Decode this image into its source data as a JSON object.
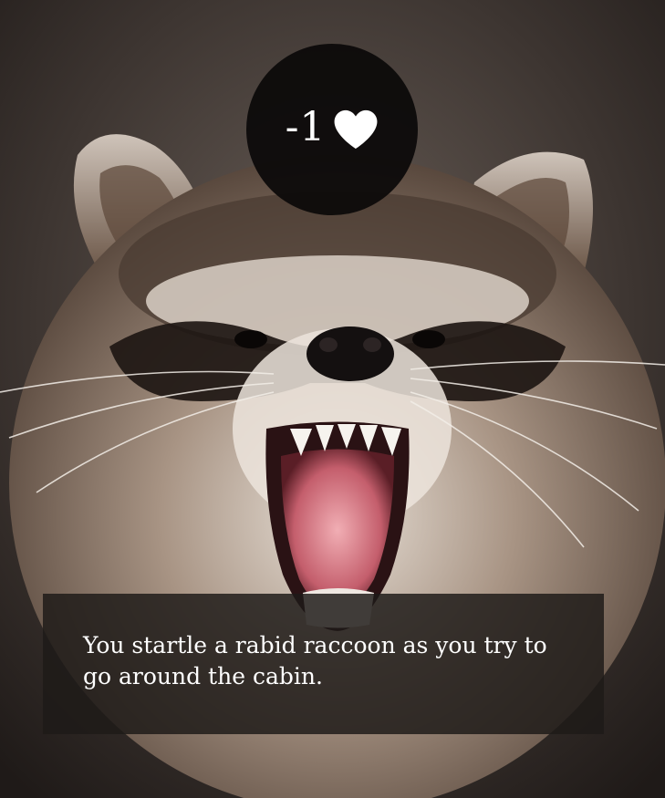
{
  "scene": {
    "image_subject": "rabid-raccoon"
  },
  "health_change": {
    "value": "-1",
    "icon": "heart-icon",
    "icon_color": "#ffffff",
    "badge_color": "#0c0a0a"
  },
  "caption": {
    "text": "You startle a rabid raccoon as you try to go around the cabin."
  }
}
